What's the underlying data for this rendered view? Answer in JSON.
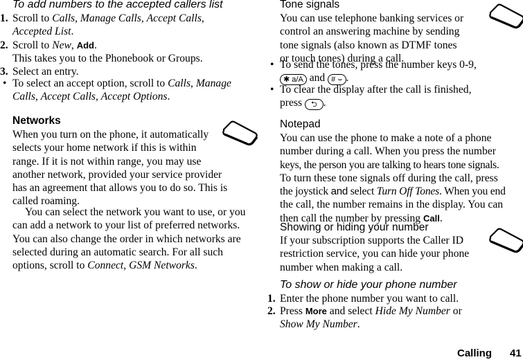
{
  "left": {
    "accepted_callers": {
      "heading": "To add numbers to the accepted callers list",
      "steps": [
        {
          "num": "1.",
          "pre": "Scroll to ",
          "i1": "Calls",
          "s1": ", ",
          "i2": "Manage Calls",
          "s2": ", ",
          "i3": "Accept Calls",
          "s3": ",",
          "i4": "Accepted List",
          "s4": "."
        },
        {
          "num": "2.",
          "pre": "Scroll to ",
          "i1": "New",
          "s1": ", ",
          "key": "Add",
          "s2": ".",
          "line2": "This takes you to the Phonebook or Groups."
        },
        {
          "num": "3.",
          "text": "Select an entry."
        }
      ],
      "bullet": {
        "symbol": "•",
        "pre": "To select an accept option, scroll to ",
        "i1": "Calls",
        "s1": ", ",
        "i2": "Manage",
        "i3": "Calls",
        "s2": ", ",
        "i4": "Accept Calls",
        "s3": ", ",
        "i5": "Accept Options",
        "s4": "."
      }
    },
    "networks": {
      "heading": "Networks",
      "lines": [
        "When you turn on the phone, it automatically",
        "selects your home network if this is within",
        "range. If it is not within range, you may use",
        "another network, provided your service provider",
        "has an agreement that allows you to do so. This is",
        "called roaming."
      ],
      "para2_lines": [
        "You can select the network you want to use, or you",
        "can add a network to your list of preferred networks.",
        "You can also change the order in which networks are",
        "selected during an automatic search. For all such"
      ],
      "para2_last_pre": "options, scroll to ",
      "para2_i1": "Connect",
      "para2_s1": ", ",
      "para2_i2": "GSM Networks",
      "para2_s2": "."
    }
  },
  "right": {
    "tone_signals": {
      "heading": "Tone signals",
      "lines": [
        "You can use telephone banking services or",
        "control an answering machine by sending",
        "tone signals (also known as DTMF tones",
        "or touch tones) during a call."
      ],
      "bullet1_line1": "To send the tones, press the number keys 0-9,",
      "bullet1_key1": "✱ a/A",
      "bullet1_and": " and ",
      "bullet1_key2": "# ⌣",
      "bullet1_end": ".",
      "bullet2_line1": "To clear the display after the call is finished,",
      "bullet2_pre": "press ",
      "bullet2_key": "⮌",
      "bullet2_end": ".",
      "bullet_symbol": "•"
    },
    "notepad": {
      "heading": "Notepad",
      "lines": [
        "You can use the phone to make a note of a phone",
        "number during a call. When you press the number",
        "keys, the person you are talking to hears tone signals.",
        "To turn these tone signals off during the call, press"
      ],
      "line5_pre": "the joystick ",
      "line5_and": "and",
      "line5_mid": " select ",
      "line5_i": "Turn Off Tones",
      "line5_post": ". When you end",
      "line6": "the call, the number remains in the display. You can",
      "line7_pre": "then call the number by pressing ",
      "line7_key": "Call",
      "line7_end": "."
    },
    "hide_number": {
      "heading": "Showing or hiding your number",
      "lines": [
        "If your subscription supports the Caller ID",
        "restriction service, you can hide your phone",
        "number when making a call."
      ],
      "subheading": "To show or hide your phone number",
      "step1_num": "1.",
      "step1": "Enter the phone number you want to call.",
      "step2_num": "2.",
      "step2_pre": "Press ",
      "step2_key": "More",
      "step2_mid": " and select ",
      "step2_i1": "Hide My Number",
      "step2_or": " or",
      "step2_i2": "Show My Number",
      "step2_end": "."
    }
  },
  "footer": {
    "section": "Calling",
    "page": "41"
  },
  "icons": {
    "phone_icon": "phone-display-icon"
  }
}
